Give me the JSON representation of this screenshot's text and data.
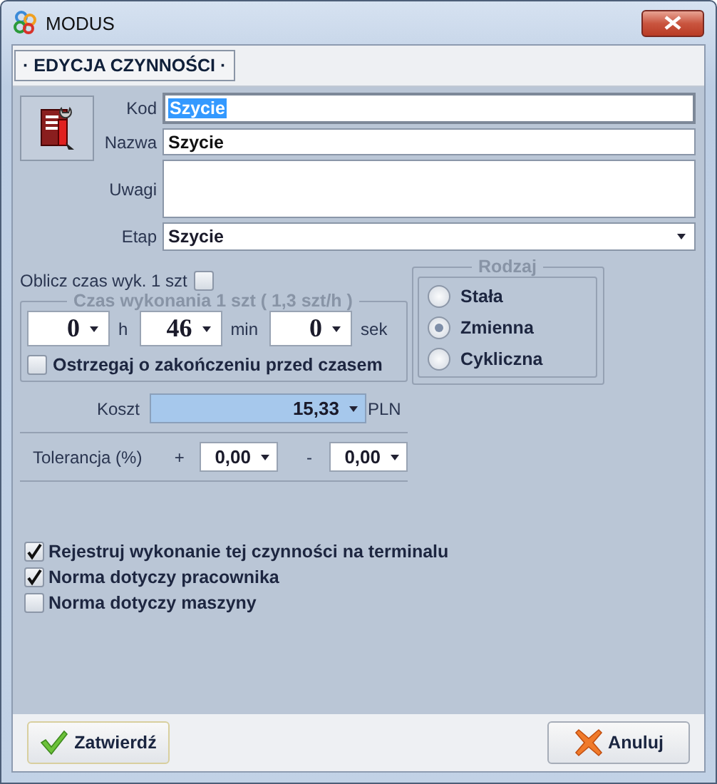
{
  "window": {
    "title": "MODUS"
  },
  "section_tab": "· EDYCJA CZYNNOŚCI ·",
  "fields": [
    {
      "label": "Kod",
      "value": "Szycie",
      "kind": "text",
      "focused": true
    },
    {
      "label": "Nazwa",
      "value": "Szycie",
      "kind": "text",
      "focused": false
    },
    {
      "label": "Uwagi",
      "kind": "memo",
      "focused": false
    },
    {
      "label": "Etap",
      "value": "Szycie",
      "kind": "dropdown",
      "focused": false
    }
  ],
  "calc_time": {
    "label": "Oblicz czas wyk. 1 szt",
    "checked": false
  },
  "duration": {
    "title": "Czas wykonania 1 szt ( 1,3 szt/h )",
    "parts": [
      {
        "value": "0",
        "unit": "h"
      },
      {
        "value": "46",
        "unit": "min"
      },
      {
        "value": "0",
        "unit": "sek"
      }
    ],
    "warn": {
      "label": "Ostrzegaj o zakończeniu przed czasem",
      "checked": false
    }
  },
  "type_group": {
    "title": "Rodzaj",
    "options": [
      {
        "label": "Stała",
        "selected": false
      },
      {
        "label": "Zmienna",
        "selected": true
      },
      {
        "label": "Cykliczna",
        "selected": false
      }
    ]
  },
  "cost": {
    "label": "Koszt",
    "value": "15,33",
    "currency": "PLN"
  },
  "tolerance": {
    "label": "Tolerancja (%)",
    "plus_sign": "+",
    "plus_value": "0,00",
    "minus_sign": "-",
    "minus_value": "0,00"
  },
  "options": [
    {
      "label": "Rejestruj wykonanie tej czynności na terminalu",
      "checked": true
    },
    {
      "label": "Norma dotyczy pracownika",
      "checked": true
    },
    {
      "label": "Norma dotyczy maszyny",
      "checked": false
    }
  ],
  "buttons": [
    {
      "label": "Zatwierdź",
      "kind": "confirm"
    },
    {
      "label": "Anuluj",
      "kind": "cancel"
    }
  ]
}
